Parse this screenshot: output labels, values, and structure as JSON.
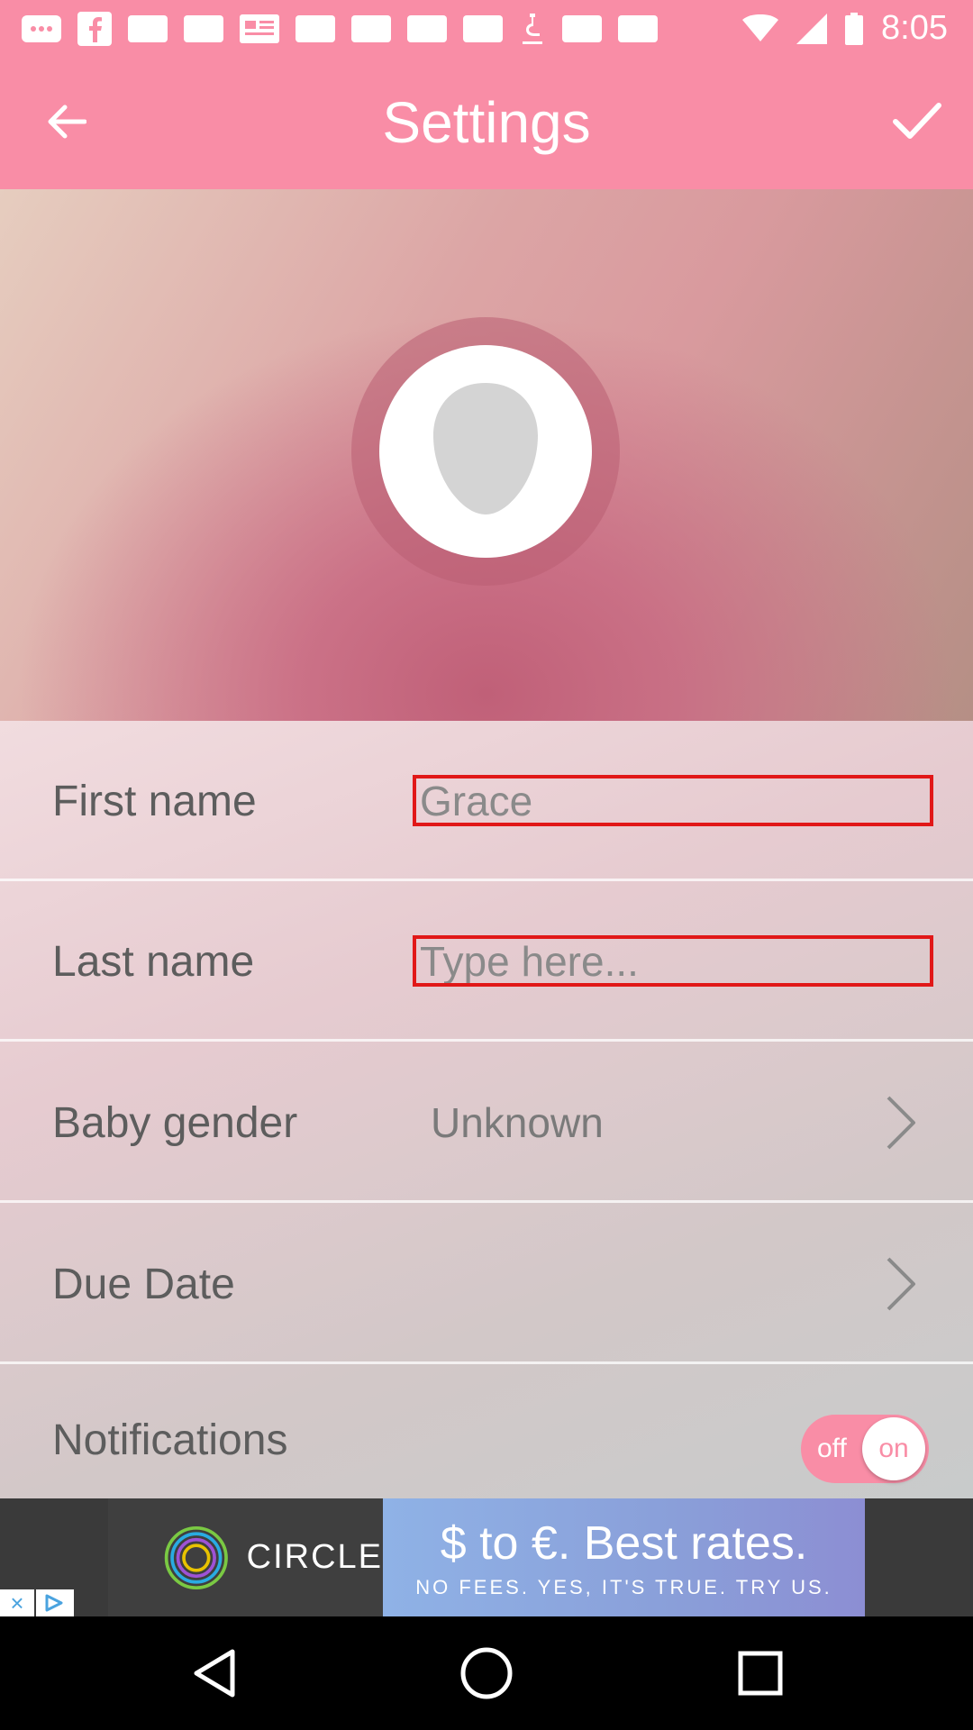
{
  "status_bar": {
    "time": "8:05",
    "icons": [
      "more-icon",
      "facebook-icon",
      "square-icon",
      "square-icon",
      "news-icon",
      "square-icon",
      "square-icon",
      "square-icon",
      "square-icon",
      "microscope-icon",
      "square-icon",
      "square-icon"
    ],
    "right_icons": [
      "wifi-icon",
      "signal-icon",
      "battery-icon"
    ]
  },
  "app_bar": {
    "title": "Settings",
    "back_icon": "arrow-left-icon",
    "confirm_icon": "check-icon"
  },
  "profile": {
    "avatar_icon": "user-silhouette-icon"
  },
  "form": {
    "first_name": {
      "label": "First name",
      "value": "Grace",
      "placeholder": ""
    },
    "last_name": {
      "label": "Last name",
      "value": "",
      "placeholder": "Type here..."
    },
    "baby_gender": {
      "label": "Baby gender",
      "value": "Unknown"
    },
    "due_date": {
      "label": "Due Date",
      "value": ""
    },
    "notifications": {
      "label": "Notifications",
      "toggle_off": "off",
      "toggle_on": "on",
      "state": "on"
    }
  },
  "ad": {
    "brand": "CIRCLE",
    "headline": "$ to €. Best rates.",
    "subtext": "NO FEES. YES, IT'S TRUE. TRY US.",
    "close_label": "×"
  },
  "colors": {
    "primary": "#f98da6",
    "field_border": "#e11818",
    "label_text": "#5d5d5d"
  }
}
